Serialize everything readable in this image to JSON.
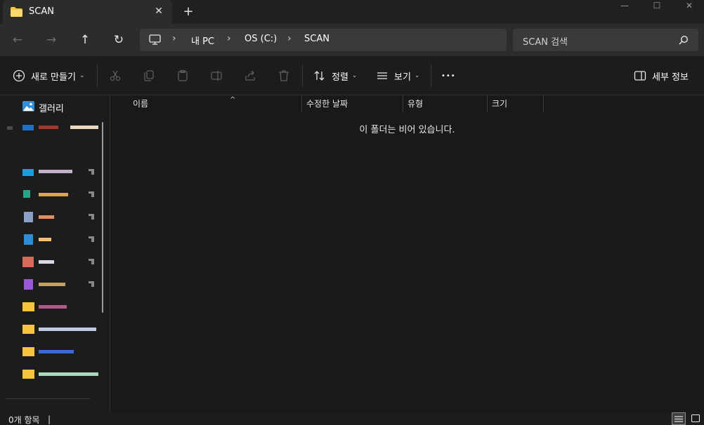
{
  "window": {
    "tab_title": "SCAN",
    "close_tab_glyph": "✕",
    "new_tab_glyph": "+",
    "minimize_glyph": "—",
    "maximize_glyph": "☐",
    "close_glyph": "✕"
  },
  "nav": {
    "back_glyph": "←",
    "forward_glyph": "→",
    "up_glyph": "↑",
    "refresh_glyph": "↻"
  },
  "breadcrumb": {
    "sep": "›",
    "items": [
      "내 PC",
      "OS (C:)",
      "SCAN"
    ]
  },
  "search": {
    "placeholder": "SCAN 검색"
  },
  "commands": {
    "new_label": "새로 만들기",
    "sort_label": "정렬",
    "view_label": "보기",
    "more_glyph": "•••",
    "details_label": "세부 정보",
    "chevron": "⌄"
  },
  "sidebar": {
    "gallery_label": "갤러리"
  },
  "columns": {
    "name": "이름",
    "modified": "수정한 날짜",
    "type": "유형",
    "size": "크기",
    "sort_caret": "^"
  },
  "main": {
    "empty_message": "이 폴더는 비어 있습니다."
  },
  "status": {
    "item_count": "0개 항목",
    "cursor": "|"
  },
  "colors": {
    "accent": "#4cc2ff",
    "folder": "#f8c33c",
    "window_bg": "#191919",
    "bar_bg": "#2c2c2c"
  }
}
